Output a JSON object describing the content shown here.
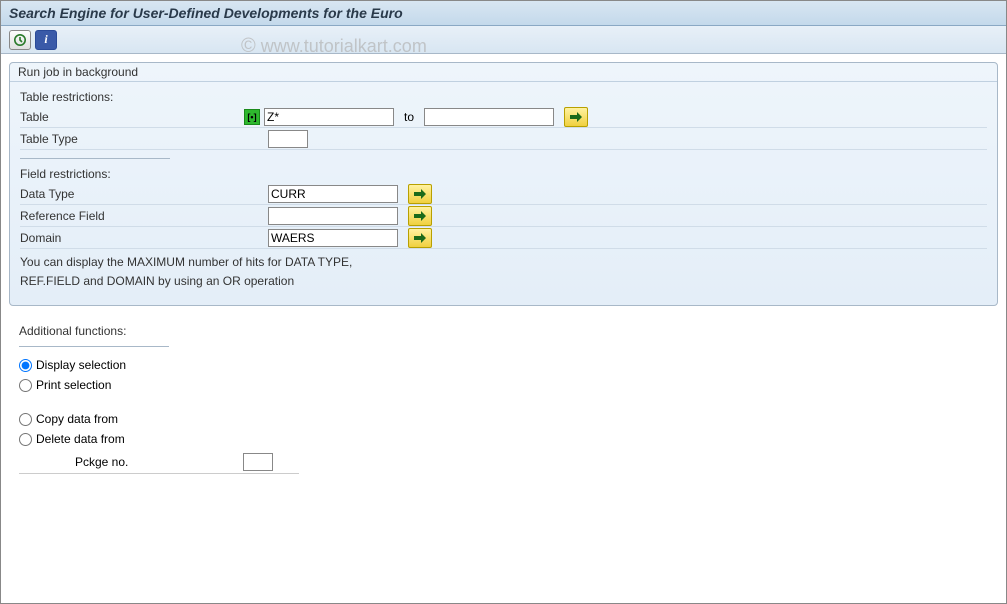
{
  "header": {
    "title": "Search Engine for User-Defined Developments for the Euro"
  },
  "watermark": "© www.tutorialkart.com",
  "group": {
    "title": "Run job in background",
    "table_section": {
      "heading": "Table restrictions:",
      "table_label": "Table",
      "table_from": "Z*",
      "to_label": "to",
      "table_to": "",
      "table_type_label": "Table Type",
      "table_type": ""
    },
    "field_section": {
      "heading": "Field restrictions:",
      "data_type_label": "Data Type",
      "data_type": "CURR",
      "ref_field_label": "Reference Field",
      "ref_field": "",
      "domain_label": "Domain",
      "domain": "WAERS",
      "hint_line1": "You can display the MAXIMUM number of hits for DATA TYPE,",
      "hint_line2": "REF.FIELD and DOMAIN by using an OR operation"
    }
  },
  "additional": {
    "heading": "Additional functions:",
    "display_sel": "Display selection",
    "print_sel": "Print selection",
    "copy_from": "Copy data from",
    "delete_from": "Delete data from",
    "pkg_label": "Pckge no.",
    "pkg_value": ""
  }
}
